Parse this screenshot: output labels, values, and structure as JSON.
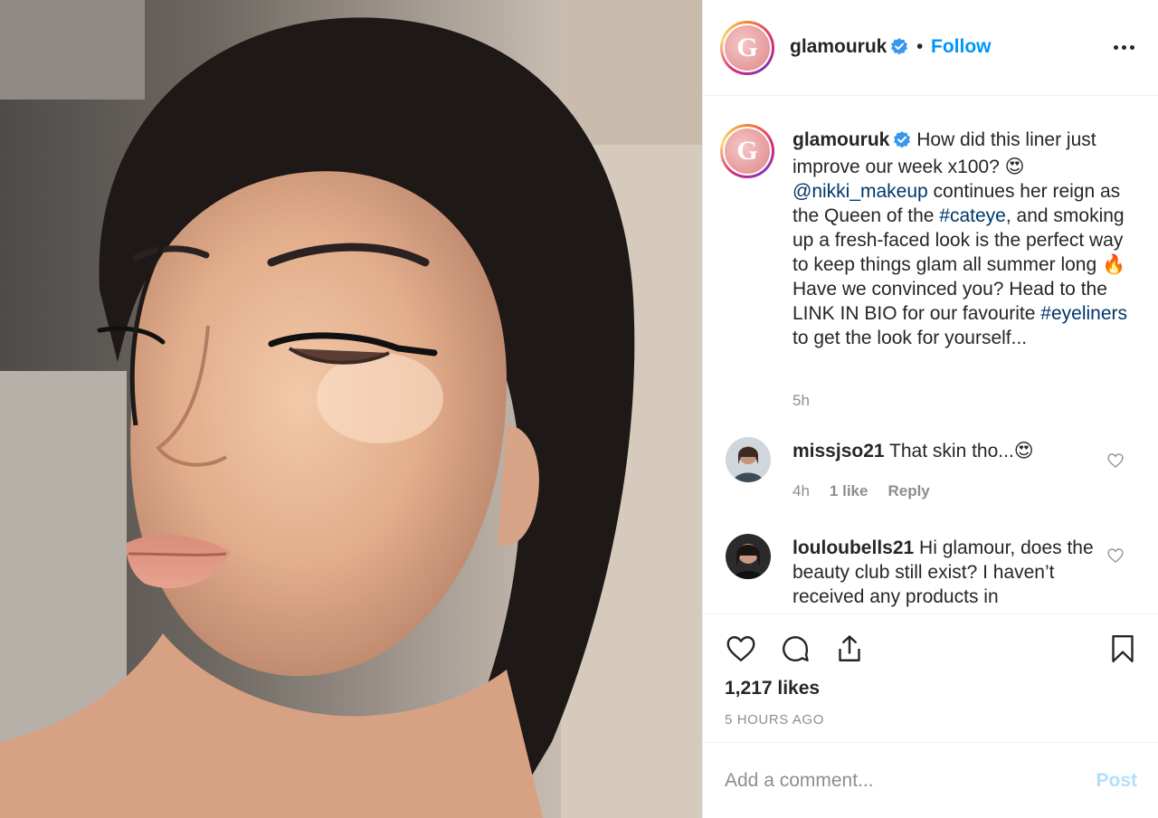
{
  "photo": {
    "description_icon": "portrait-photo"
  },
  "header": {
    "username": "glamouruk",
    "verified_icon": "verified-badge-icon",
    "separator": "•",
    "follow_label": "Follow",
    "more_icon": "more-options-icon",
    "avatar_letter": "G"
  },
  "caption": {
    "username": "glamouruk",
    "text_1": "How did this liner just improve our week x100? 😍",
    "mention": "@nikki_makeup",
    "text_2": " continues her reign as the Queen of the ",
    "hashtag_1": "#cateye",
    "text_3": ", and smoking up a fresh-faced look is the perfect way to keep things glam all summer long 🔥  Have we convinced you? Head to the LINK IN BIO for our favourite ",
    "hashtag_2": "#eyeliners",
    "text_4": " to get the look for yourself...",
    "time": "5h"
  },
  "comments": [
    {
      "username": "missjso21",
      "text": "That skin tho...😍",
      "time": "4h",
      "likes": "1 like",
      "reply": "Reply"
    },
    {
      "username": "louloubells21",
      "text": "Hi glamour, does the beauty club still exist? I haven’t received any products in"
    }
  ],
  "actions": {
    "like_icon": "heart-icon",
    "comment_icon": "comment-icon",
    "share_icon": "share-icon",
    "save_icon": "bookmark-icon",
    "likes": "1,217 likes",
    "posted_ago": "5 HOURS AGO"
  },
  "add_comment": {
    "placeholder": "Add a comment...",
    "post_label": "Post"
  },
  "colors": {
    "link_blue": "#0095f6",
    "hashtag": "#00376b",
    "muted": "#8e8e8e",
    "post_disabled": "#b2dffc"
  }
}
